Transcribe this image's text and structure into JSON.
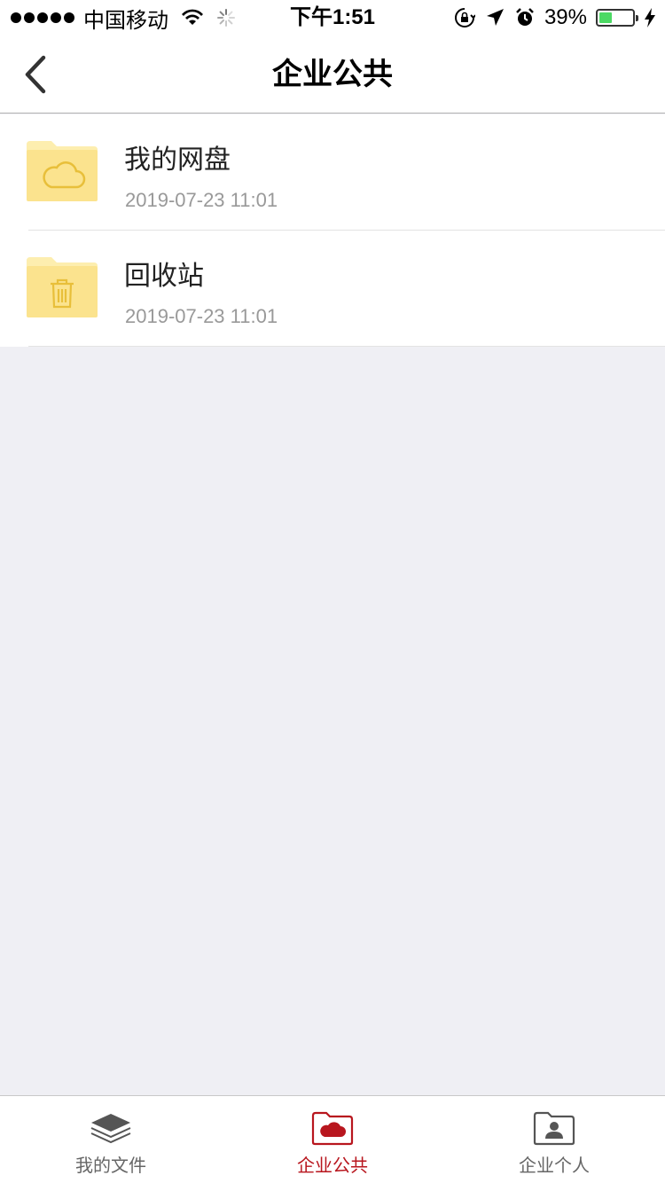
{
  "status_bar": {
    "carrier": "中国移动",
    "time": "下午1:51",
    "battery_percent": "39%",
    "battery_level": 0.39,
    "battery_color": "#4cd964"
  },
  "nav": {
    "title": "企业公共",
    "back_icon": "chevron-left-icon"
  },
  "files": [
    {
      "name": "我的网盘",
      "date": "2019-07-23 11:01",
      "icon": "cloud-folder-icon"
    },
    {
      "name": "回收站",
      "date": "2019-07-23 11:01",
      "icon": "trash-folder-icon"
    }
  ],
  "tabs": [
    {
      "label": "我的文件",
      "icon": "layers-icon",
      "active": false
    },
    {
      "label": "企业公共",
      "icon": "cloud-folder-icon",
      "active": true
    },
    {
      "label": "企业个人",
      "icon": "person-folder-icon",
      "active": false
    }
  ],
  "colors": {
    "accent": "#b8161e",
    "folder": "#fbe38e",
    "folder_tab": "#fdeeaf",
    "folder_glyph": "#e8bf3a",
    "background": "#efeff4"
  }
}
